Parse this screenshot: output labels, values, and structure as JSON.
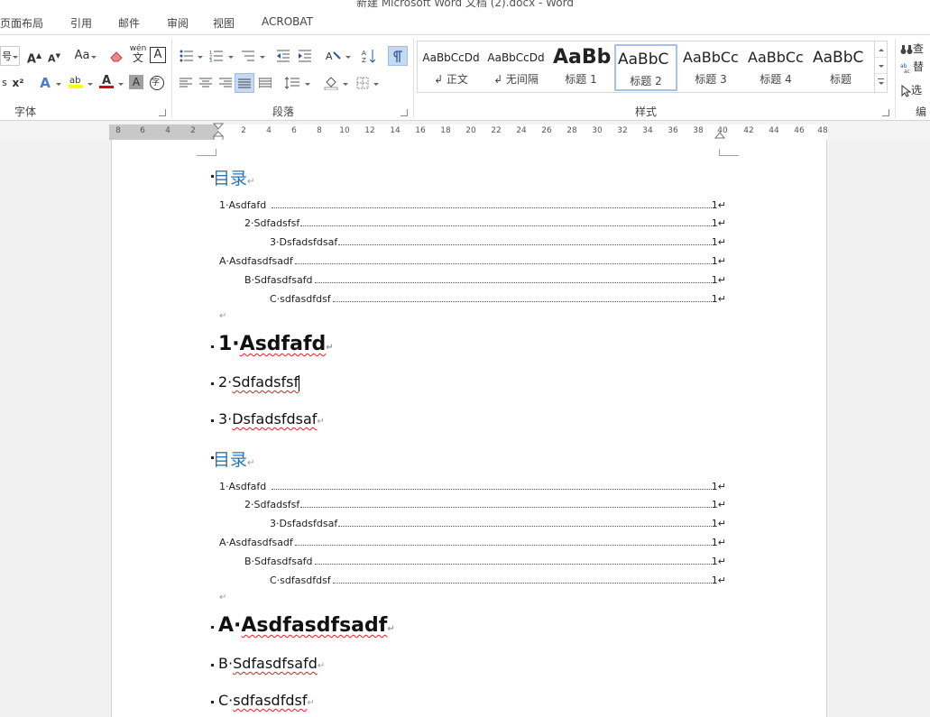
{
  "window": {
    "title": "新建 Microsoft Word 文档 (2).docx - Word"
  },
  "tabs": [
    "页面布局",
    "引用",
    "邮件",
    "审阅",
    "视图",
    "ACROBAT"
  ],
  "ribbon": {
    "groups": {
      "font": "字体",
      "paragraph": "段落",
      "styles": "样式",
      "editing": "编"
    },
    "font_size_value": "号",
    "case_label": "Aa",
    "phonetic_label": "wén",
    "phonetic_char": "文",
    "border_char_label": "A",
    "superscript": "x²",
    "subscript": "x₂",
    "encircle_label": "字",
    "editing": {
      "find": "查",
      "replace": "替",
      "select": "选"
    },
    "styles": [
      {
        "sample": "AaBbCcDd",
        "name": "↲ 正文"
      },
      {
        "sample": "AaBbCcDd",
        "name": "↲ 无间隔"
      },
      {
        "sample": "AaBb",
        "name": "标题 1"
      },
      {
        "sample": "AaBbC",
        "name": "标题 2"
      },
      {
        "sample": "AaBbCc",
        "name": "标题 3"
      },
      {
        "sample": "AaBbCc",
        "name": "标题 4"
      },
      {
        "sample": "AaBbC",
        "name": "标题"
      }
    ],
    "colors": {
      "highlight": "#ffff00",
      "font_color": "#e00000",
      "accent": "#2b579a"
    }
  },
  "ruler": {
    "numbers": [
      "8",
      "6",
      "4",
      "2",
      "",
      "2",
      "4",
      "6",
      "8",
      "10",
      "12",
      "14",
      "16",
      "18",
      "20",
      "22",
      "24",
      "26",
      "28",
      "30",
      "32",
      "34",
      "36",
      "38",
      "40",
      "42",
      "44",
      "46",
      "48"
    ]
  },
  "document": {
    "toc_title": "目录",
    "toc1": [
      {
        "text": "1·Asdfafd",
        "page": "1↵"
      },
      {
        "text": "2·Sdfadsfsf",
        "page": "1↵"
      },
      {
        "text": "3·Dsfadsfdsaf",
        "page": "1↵"
      },
      {
        "text": "A·Asdfasdfsadf",
        "page": "1↵"
      },
      {
        "text": "B·Sdfasdfsafd",
        "page": "1↵"
      },
      {
        "text": "C·sdfasdfdsf",
        "page": "1↵"
      }
    ],
    "toc2": [
      {
        "text": "1·Asdfafd",
        "page": "1↵"
      },
      {
        "text": "2·Sdfadsfsf",
        "page": "1↵"
      },
      {
        "text": "3·Dsfadsfdsaf",
        "page": "1↵"
      },
      {
        "text": "A·Asdfasdfsadf",
        "page": "1↵"
      },
      {
        "text": "B·Sdfasdfsafd",
        "page": "1↵"
      },
      {
        "text": "C·sdfasdfdsf",
        "page": "1↵"
      }
    ],
    "empty_para": "↵",
    "headings": {
      "h1_num": "1·",
      "h1_text": "Asdfafd",
      "h2a_num": "2·",
      "h2a_text": "Sdfadsfsf",
      "h2b_num": "3·",
      "h2b_text": "Dsfadsfdsaf",
      "h1b_num": "A·",
      "h1b_text": "Asdfasdfsadf",
      "h2c_num": "B·",
      "h2c_text": "Sdfasdfsafd",
      "h2d_num": "C·",
      "h2d_text": "sdfasdfdsf"
    },
    "para_mark": "↵"
  }
}
